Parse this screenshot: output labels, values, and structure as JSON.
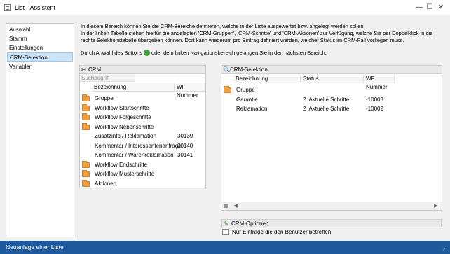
{
  "window": {
    "title": "List - Assistent",
    "minimize_symbol": "—",
    "maximize_symbol": "☐",
    "close_symbol": "✕"
  },
  "nav": {
    "items": [
      {
        "label": "Auswahl"
      },
      {
        "label": "Stamm"
      },
      {
        "label": "Einstellungen"
      },
      {
        "label": "CRM-Selektion",
        "active": true
      },
      {
        "label": "Variablen"
      }
    ]
  },
  "description": {
    "line1": "In diesem Bereich können Sie die CRM-Bereiche definieren, welche in der Liste ausgewertet bzw. angelegt werden sollen.",
    "line2": "In der linken Tabelle stehen hierfür die angelegten 'CRM-Gruppen', 'CRM-Schritte' und 'CRM-Aktionen' zur Verfügung, welche Sie per Doppelklick in die",
    "line3": "rechte Selektionstabelle übergeben können. Dort kann wiederum pro Eintrag definiert werden, welcher Status im CRM-Fall vorliegen muss.",
    "line4_a": "Durch Anwahl des Buttons",
    "line4_b": "oder dem linken Navigationsbereich gelangen Sie in den nächsten Bereich."
  },
  "crm_panel": {
    "title": "CRM",
    "search_label": "Suchbegriff",
    "search_value": "",
    "columns": [
      "Bezeichnung",
      "WF Nummer"
    ],
    "rows": [
      {
        "label": "Gruppe",
        "number": "",
        "folder": true
      },
      {
        "label": "Workflow Startschritte",
        "number": "",
        "folder": true
      },
      {
        "label": "Workflow Folgeschritte",
        "number": "",
        "folder": true
      },
      {
        "label": "Workflow Nebenschritte",
        "number": "",
        "folder": true
      },
      {
        "label": "Zusatzinfo / Reklamation",
        "number": "30139",
        "folder": false
      },
      {
        "label": "Kommentar / Interessentenanfrage",
        "number": "30140",
        "folder": false
      },
      {
        "label": "Kommentar / Warenreklamation",
        "number": "30141",
        "folder": false
      },
      {
        "label": "Workflow Endschritte",
        "number": "",
        "folder": true
      },
      {
        "label": "Workflow Musterschritte",
        "number": "",
        "folder": true
      },
      {
        "label": "Aktionen",
        "number": "",
        "folder": true
      }
    ]
  },
  "selection_panel": {
    "title": "CRM-Selektion",
    "columns": [
      "Bezeichnung",
      "Status",
      "WF Nummer"
    ],
    "rows": [
      {
        "label": "Gruppe",
        "status": "",
        "number": "",
        "folder": true
      },
      {
        "label": "Garantie",
        "status": "2  Aktuelle Schritte",
        "number": "-10003",
        "folder": false
      },
      {
        "label": "Reklamation",
        "status": "2  Aktuelle Schritte",
        "number": "-10002",
        "folder": false
      }
    ]
  },
  "options": {
    "title": "CRM-Optionen",
    "checkbox_label": "Nur Einträge die den Benutzer betreffen",
    "checkbox_checked": false
  },
  "statusbar": {
    "text": "Neuanlage einer Liste"
  }
}
